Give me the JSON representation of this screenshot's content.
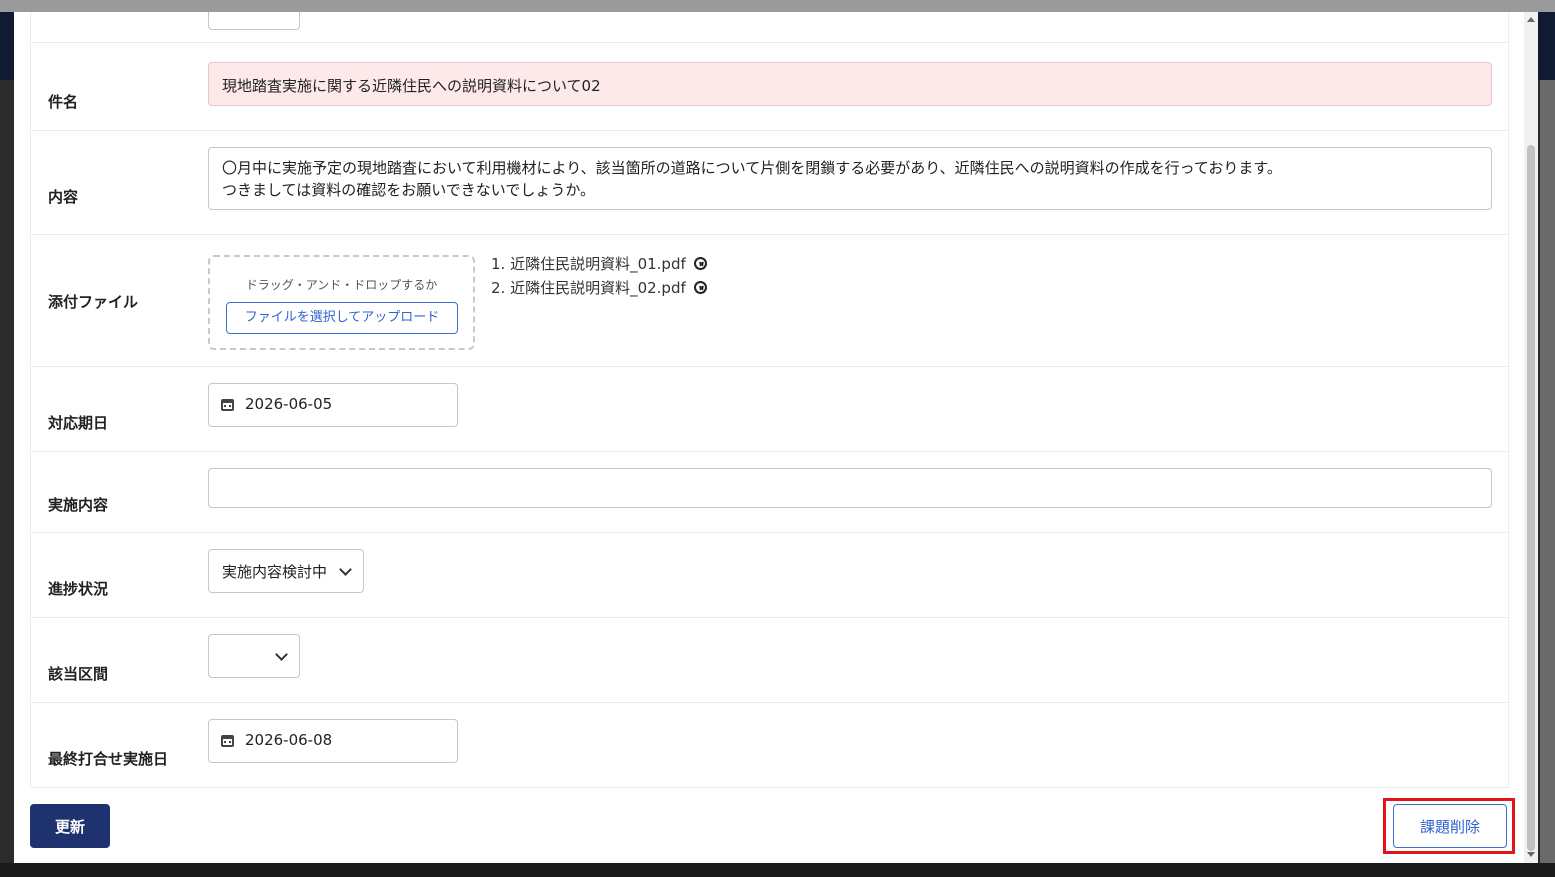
{
  "form": {
    "subject": {
      "label": "件名",
      "value": "現地踏査実施に関する近隣住民への説明資料について02"
    },
    "content": {
      "label": "内容",
      "line1": "〇月中に実施予定の現地踏査において利用機材により、該当箇所の道路について片側を閉鎖する必要があり、近隣住民への説明資料の作成を行っております。",
      "line2": "つきましては資料の確認をお願いできないでしょうか。"
    },
    "attachment": {
      "label": "添付ファイル",
      "drop_hint": "ドラッグ・アンド・ドロップするか",
      "upload_button": "ファイルを選択してアップロード",
      "files": [
        {
          "label": "1. 近隣住民説明資料_01.pdf"
        },
        {
          "label": "2. 近隣住民説明資料_02.pdf"
        }
      ]
    },
    "due_date": {
      "label": "対応期日",
      "value": "2026-06-05",
      "icon": "calendar-icon"
    },
    "implementation": {
      "label": "実施内容",
      "value": ""
    },
    "progress": {
      "label": "進捗状況",
      "selected": "実施内容検討中"
    },
    "section": {
      "label": "該当区間",
      "selected": ""
    },
    "final_meeting_date": {
      "label": "最終打合せ実施日",
      "value": "2026-06-08",
      "icon": "calendar-icon"
    }
  },
  "footer": {
    "update_button": "更新",
    "delete_button": "課題削除"
  },
  "colors": {
    "primary": "#1f3270",
    "link": "#2f63cf",
    "subject_background": "#fde9ea",
    "highlight": "#e2141a"
  }
}
